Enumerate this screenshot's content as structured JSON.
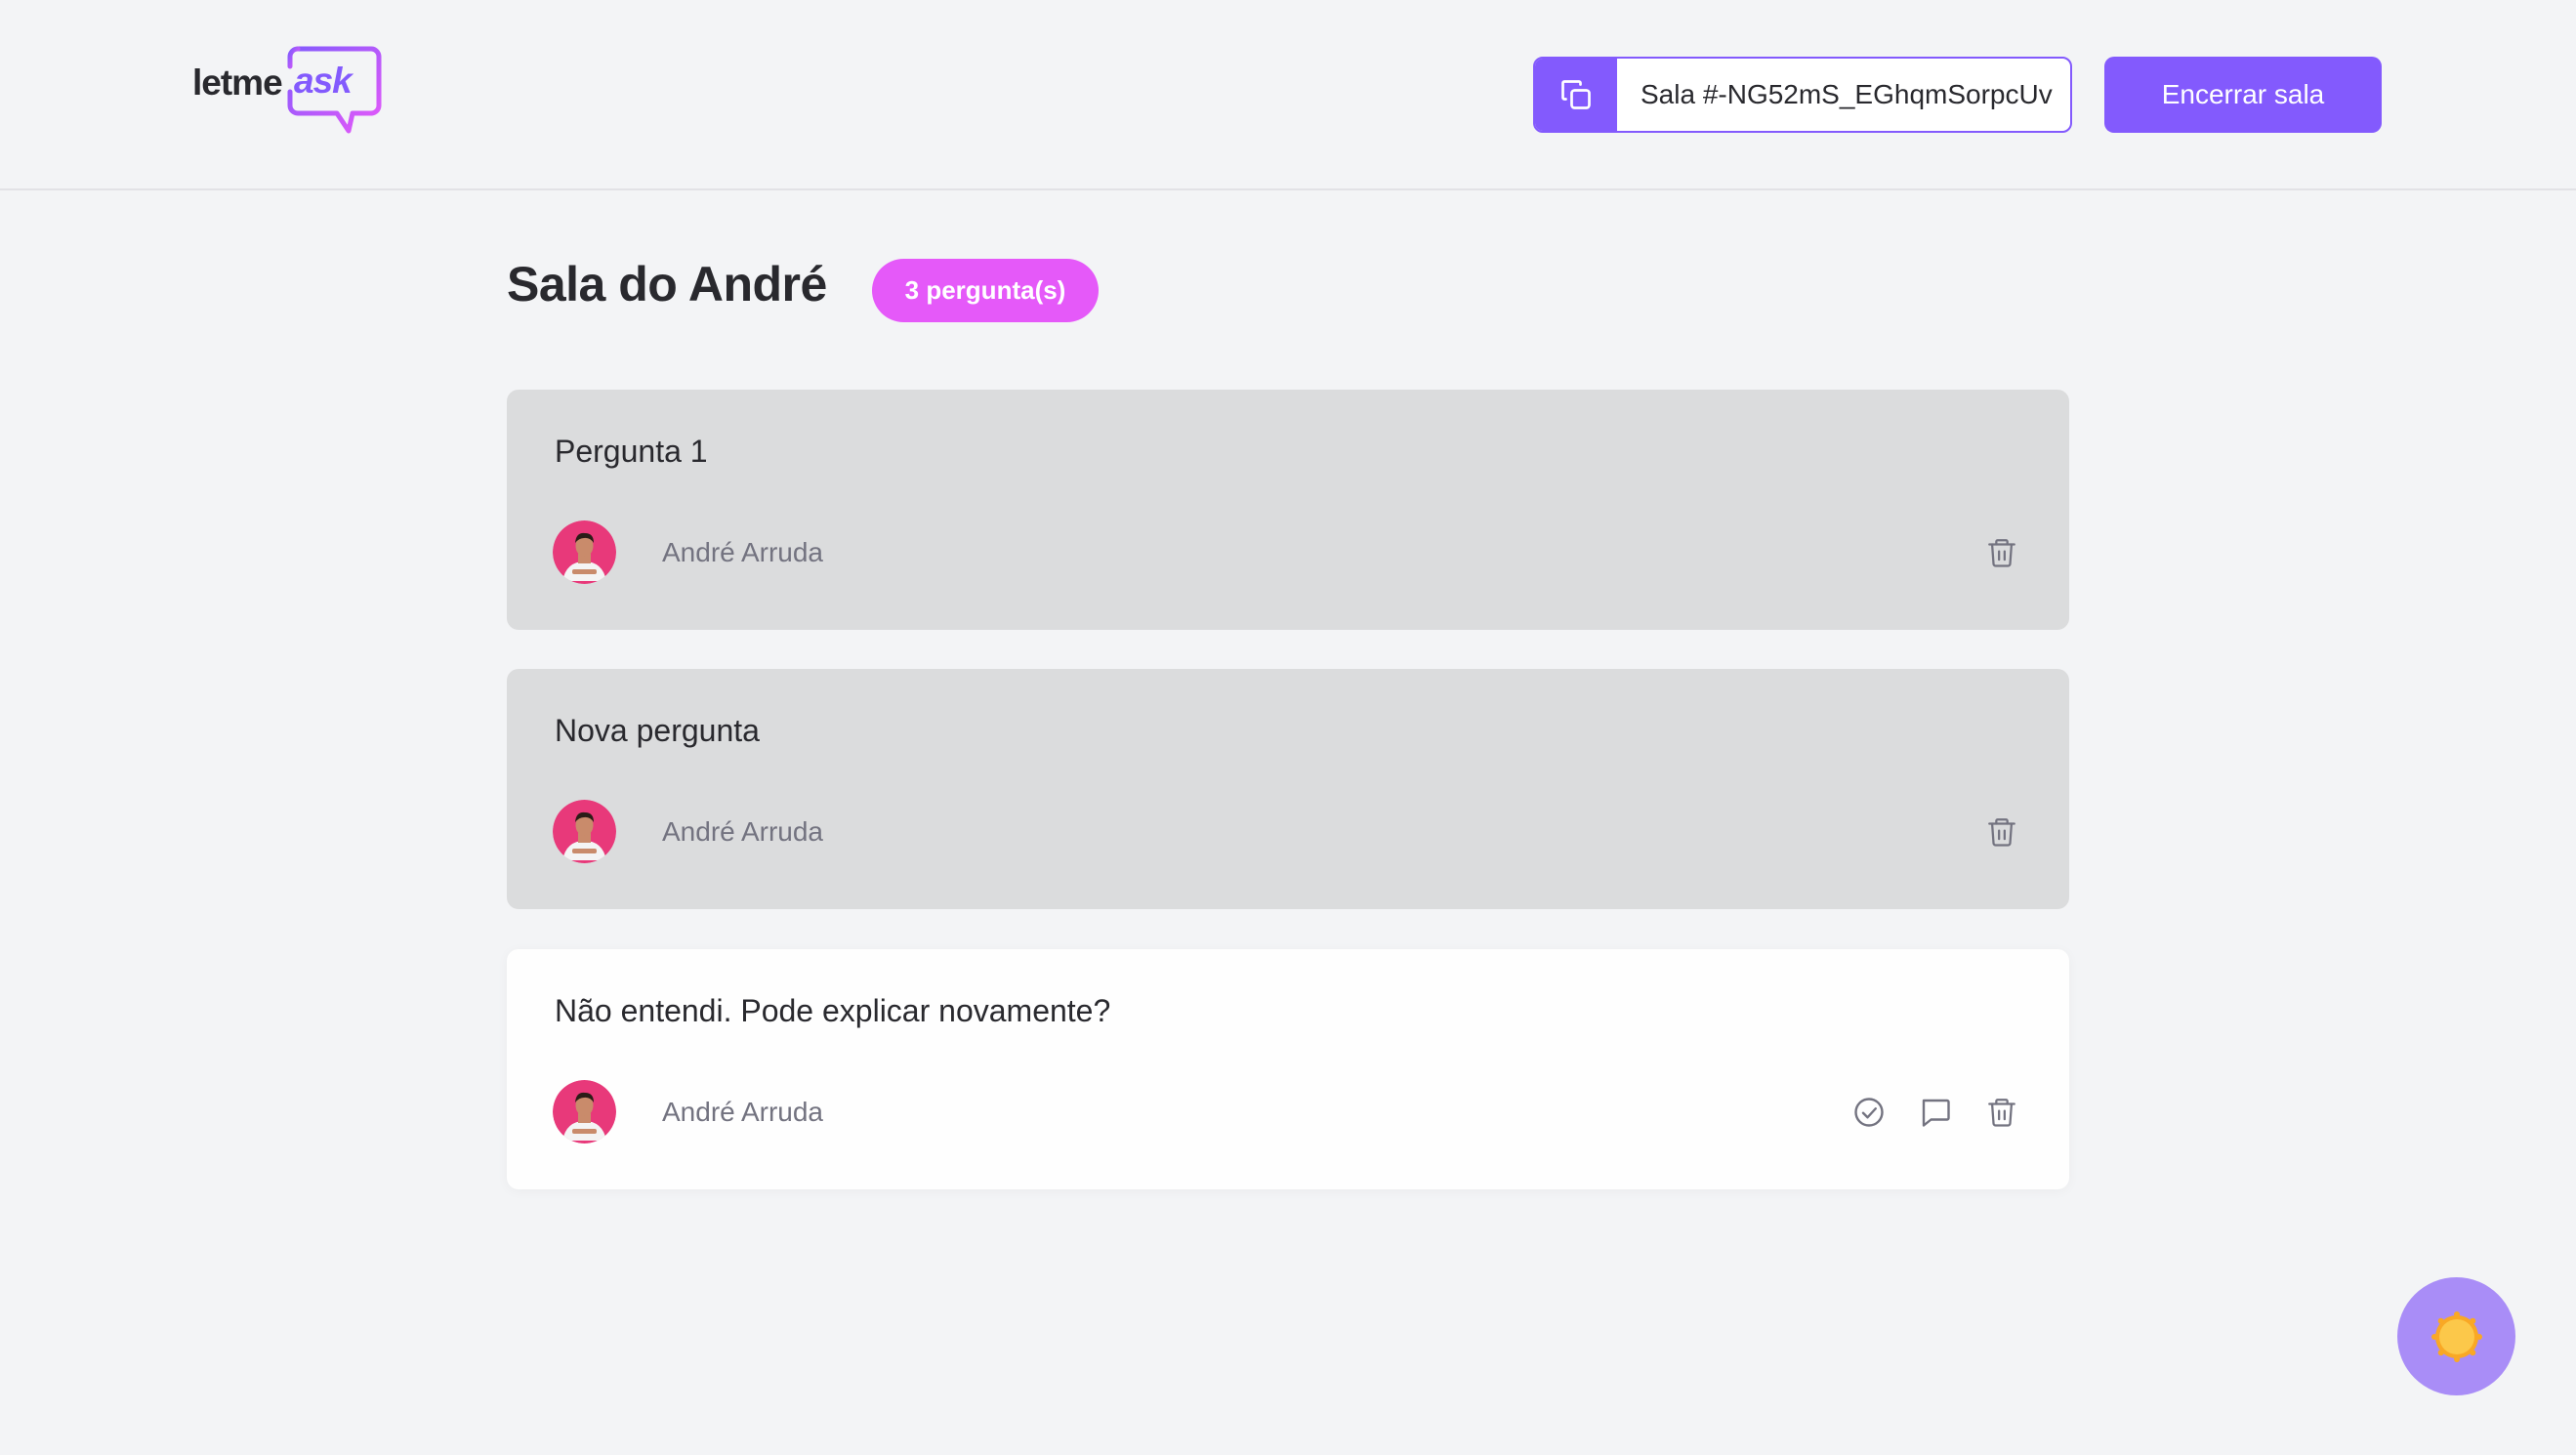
{
  "header": {
    "logo": {
      "primary": "letme",
      "accent": "ask"
    },
    "room_code": {
      "label": "Sala #-NG52mS_EGhqmSorpcUv"
    },
    "close_room_label": "Encerrar sala"
  },
  "room": {
    "title": "Sala do André",
    "question_count_label": "3 pergunta(s)"
  },
  "questions": [
    {
      "content": "Pergunta 1",
      "author": "André Arruda",
      "state": "answered",
      "actions": [
        "trash-icon"
      ]
    },
    {
      "content": "Nova pergunta",
      "author": "André Arruda",
      "state": "answered",
      "actions": [
        "trash-icon"
      ]
    },
    {
      "content": "Não entendi. Pode explicar novamente?",
      "author": "André Arruda",
      "state": "open",
      "actions": [
        "check-circle-icon",
        "chat-bubble-icon",
        "trash-icon"
      ]
    }
  ],
  "theme_toggle": {
    "icon": "sun-icon"
  },
  "colors": {
    "accent": "#835afd",
    "badge": "#e559f9",
    "background": "#f3f4f6",
    "answered_card": "#dbdcdd",
    "open_card": "#fefefe",
    "muted_text": "#737380",
    "toggle_bg": "#a98df7",
    "sun": "#fcc84a"
  }
}
